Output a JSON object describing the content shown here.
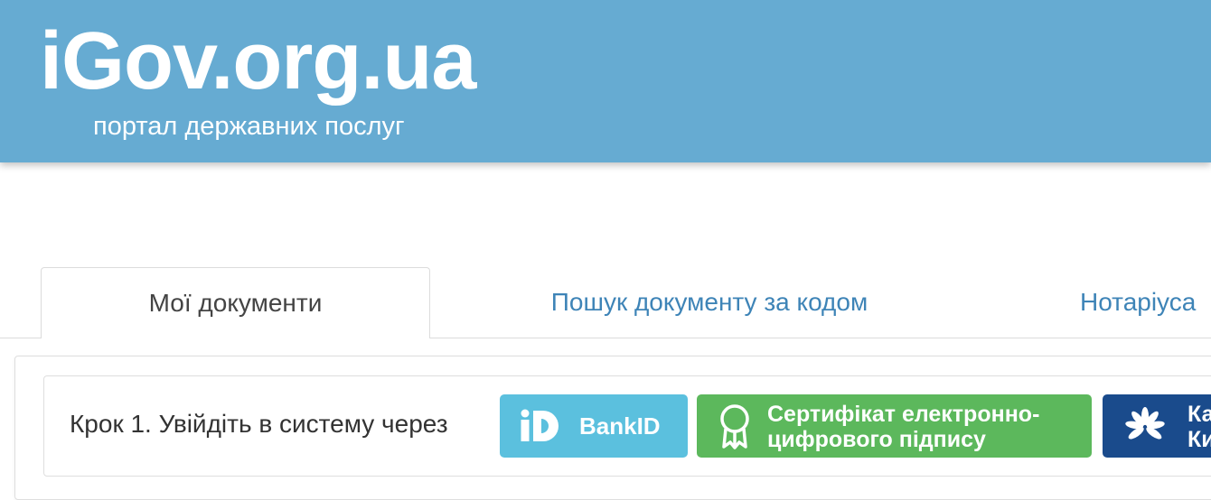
{
  "header": {
    "logo": "iGov.org.ua",
    "subtitle": "портал державних послуг"
  },
  "tabs": [
    {
      "label": "Мої документи",
      "active": true
    },
    {
      "label": "Пошук документу за кодом",
      "active": false
    },
    {
      "label": "Нотаріуса",
      "active": false
    }
  ],
  "login": {
    "step_label": "Крок 1. Увійдіть в систему через",
    "bankid_label": "BankID",
    "certificate_line1": "Сертифікат електронно-",
    "certificate_line2": "цифрового підпису",
    "kyiv_line1": "Ка",
    "kyiv_line2": "Ки"
  },
  "colors": {
    "header": "#66abd2",
    "tab_link": "#3e84b7",
    "bankid": "#5bc0de",
    "certificate": "#5cb85c",
    "kyiv": "#1a4b8c"
  },
  "icons": {
    "bankid": "bankid-logo-icon",
    "certificate": "award-ribbon-icon",
    "kyiv": "chestnut-leaf-icon"
  }
}
